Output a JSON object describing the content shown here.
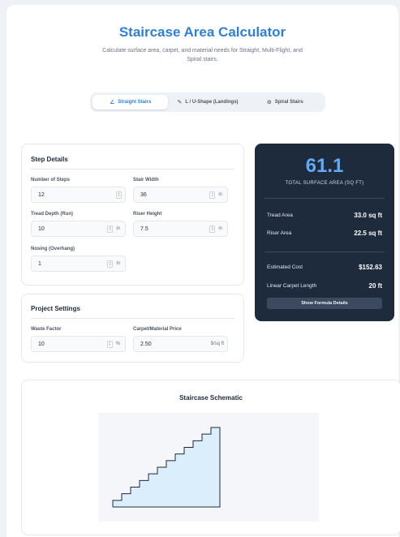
{
  "header": {
    "title": "Staircase Area Calculator",
    "subtitle": "Calculate surface area, carpet, and material needs for Straight, Multi-Flight, and Spiral stairs."
  },
  "tabs": [
    {
      "label": "Straight Stairs",
      "icon": "ruler-icon",
      "active": true
    },
    {
      "label": "L / U-Shape (Landings)",
      "icon": "pencil-icon",
      "active": false
    },
    {
      "label": "Spiral Stairs",
      "icon": "spiral-icon",
      "active": false
    }
  ],
  "step_details": {
    "title": "Step Details",
    "num_steps_label": "Number of Steps",
    "num_steps_value": "12",
    "stair_width_label": "Stair Width",
    "stair_width_value": "36",
    "stair_width_unit": "in",
    "tread_depth_label": "Tread Depth (Run)",
    "tread_depth_value": "10",
    "tread_depth_unit": "in",
    "riser_height_label": "Riser Height",
    "riser_height_value": "7.5",
    "riser_height_unit": "in",
    "nosing_label": "Nosing (Overhang)",
    "nosing_value": "1",
    "nosing_unit": "in"
  },
  "project_settings": {
    "title": "Project Settings",
    "waste_label": "Waste Factor",
    "waste_value": "10",
    "waste_unit": "%",
    "price_label": "Carpet/Material Price",
    "price_value": "2.50",
    "price_unit": "$/sq ft"
  },
  "results": {
    "total_area": "61.1",
    "total_label": "TOTAL SURFACE AREA (SQ FT)",
    "tread_area_label": "Tread Area",
    "tread_area_value": "33.0 sq ft",
    "riser_area_label": "Riser Area",
    "riser_area_value": "22.5 sq ft",
    "cost_label": "Estimated Cost",
    "cost_value": "$152.63",
    "carpet_label": "Linear Carpet Length",
    "carpet_value": "20 ft",
    "formula_button": "Show Formula Details"
  },
  "schematic": {
    "title": "Staircase Schematic",
    "steps": 12,
    "fill_color": "#dbeefb",
    "canvas_color": "#f4f6f9"
  },
  "colors": {
    "accent": "#2f7fd8",
    "results_bg": "#1e2b3d",
    "big_number": "#63aaf0"
  }
}
